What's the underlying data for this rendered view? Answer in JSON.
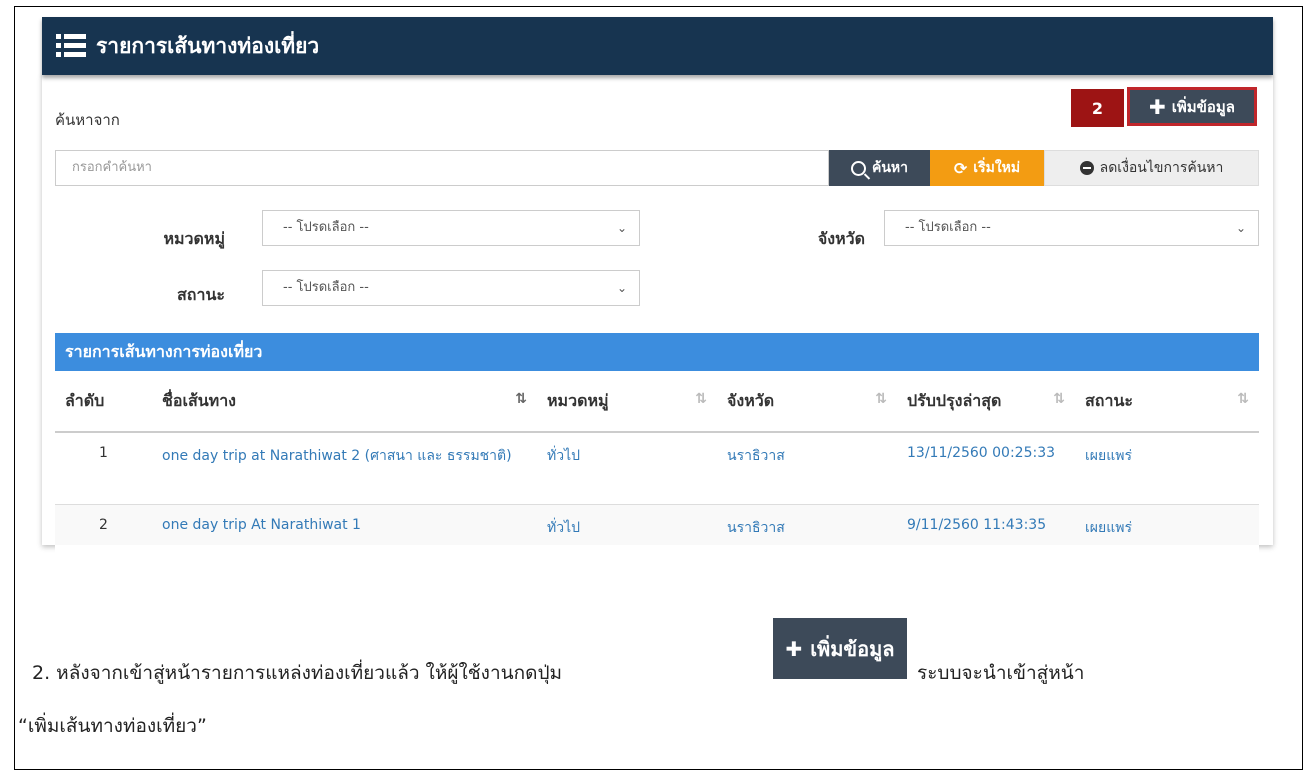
{
  "panel": {
    "title": "รายการเส้นทางท่องเที่ยว"
  },
  "toolbar": {
    "search_from": "ค้นหาจาก",
    "badge": "2",
    "add_label": "เพิ่มข้อมูล"
  },
  "search": {
    "placeholder": "กรอกคำค้นหา",
    "search_label": "ค้นหา",
    "reset_label": "เริ่มใหม่",
    "less_label": "ลดเงื่อนไขการค้นหา"
  },
  "filters": {
    "category_label": "หมวดหมู่",
    "province_label": "จังหวัด",
    "status_label": "สถานะ",
    "category_value": "-- โปรดเลือก --",
    "province_value": "-- โปรดเลือก --",
    "status_value": "-- โปรดเลือก --"
  },
  "table": {
    "heading": "รายการเส้นทางการท่องเที่ยว",
    "columns": [
      "ลำดับ",
      "ชื่อเส้นทาง",
      "หมวดหมู่",
      "จังหวัด",
      "ปรับปรุงล่าสุด",
      "สถานะ"
    ],
    "rows": [
      {
        "no": "1",
        "name": "one day trip at Narathiwat 2 (ศาสนา และ ธรรมชาติ)",
        "category": "ทั่วไป",
        "province": "นราธิวาส",
        "updated": "13/11/2560 00:25:33",
        "status": "เผยแพร่"
      },
      {
        "no": "2",
        "name": "one day trip At Narathiwat 1",
        "category": "ทั่วไป",
        "province": "นราธิวาส",
        "updated": "9/11/2560 11:43:35",
        "status": "เผยแพร่"
      }
    ]
  },
  "instructions": {
    "before": "2. หลังจากเข้าสู่หน้ารายการแหล่งท่องเที่ยวแล้ว ให้ผู้ใช้งานกดปุ่ม",
    "button": "เพิ่มข้อมูล",
    "after": "ระบบจะนำเข้าสู่หน้า",
    "line2": "“เพิ่มเส้นทางท่องเที่ยว”"
  },
  "colors": {
    "header_bg": "#173450",
    "table_head": "#3c8dde",
    "reset": "#f39c12",
    "badge": "#9d1414",
    "link": "#337ab7"
  }
}
